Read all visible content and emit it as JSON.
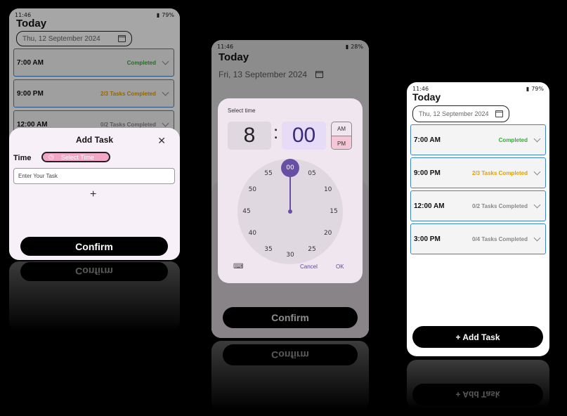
{
  "status": {
    "time": "11:46",
    "battery_a": "79%",
    "battery_b": "28%",
    "battery_c": "79%"
  },
  "screens": {
    "left": {
      "title": "Today",
      "date": "Thu, 12 September 2024",
      "tasks": [
        {
          "time": "7:00 AM",
          "status": "Completed",
          "color": "#3aa83a"
        },
        {
          "time": "9:00 PM",
          "status": "2/3 Tasks Completed",
          "color": "#e0a000"
        },
        {
          "time": "12:00 AM",
          "status": "0/2 Tasks Completed",
          "color": "#888888"
        }
      ],
      "sheet": {
        "title": "Add Task",
        "time_label": "Time",
        "select_time": "Select Time",
        "placeholder": "Enter Your Task",
        "add_symbol": "+",
        "confirm": "Confirm"
      }
    },
    "middle": {
      "title": "Today",
      "date": "Fri, 13 September 2024",
      "dialog": {
        "heading": "Select time",
        "hour": "8",
        "separator": ":",
        "minute": "00",
        "am": "AM",
        "pm": "PM",
        "selected_period": "PM",
        "dial": [
          "00",
          "05",
          "10",
          "15",
          "20",
          "25",
          "30",
          "35",
          "40",
          "45",
          "50",
          "55"
        ],
        "cancel": "Cancel",
        "ok": "OK"
      },
      "confirm": "Confirm"
    },
    "right": {
      "title": "Today",
      "date": "Thu, 12 September 2024",
      "tasks": [
        {
          "time": "7:00 AM",
          "status": "Completed",
          "color": "#3aa83a"
        },
        {
          "time": "9:00 PM",
          "status": "2/3 Tasks Completed",
          "color": "#e0a000"
        },
        {
          "time": "12:00 AM",
          "status": "0/2 Tasks Completed",
          "color": "#888888"
        },
        {
          "time": "3:00 PM",
          "status": "0/4 Tasks Completed",
          "color": "#888888"
        }
      ],
      "add_task": "+ Add Task"
    }
  },
  "colors": {
    "accent_blue": "#3c82c8",
    "picker_purple": "#6750a4",
    "pink_chip": "#f2a6c8"
  }
}
